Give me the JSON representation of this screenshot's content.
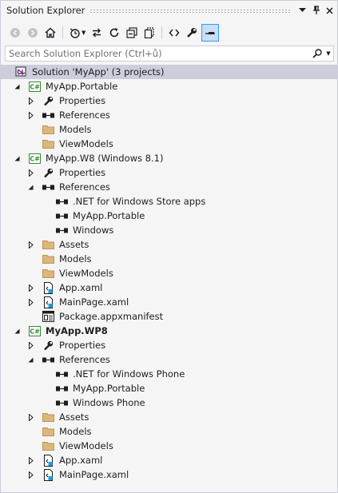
{
  "title": "Solution Explorer",
  "search": {
    "placeholder": "Search Solution Explorer (Ctrl+ů)"
  },
  "colors": {
    "folder": "#dcb67a",
    "selection": "#cccedb",
    "active_tool": "#3399ff",
    "csharp_green": "#388a34"
  },
  "solution": "Solution 'MyApp' (3 projects)",
  "projects": [
    {
      "name": "MyApp.Portable",
      "items": [
        {
          "label": "Properties",
          "icon": "wrench-icon"
        },
        {
          "label": "References",
          "icon": "references-icon"
        },
        {
          "label": "Models",
          "icon": "folder-icon"
        },
        {
          "label": "ViewModels",
          "icon": "folder-icon"
        }
      ]
    },
    {
      "name": "MyApp.W8 (Windows 8.1)",
      "items": [
        {
          "label": "Properties",
          "icon": "wrench-icon"
        },
        {
          "label": "References",
          "icon": "references-icon",
          "children": [
            ".NET for Windows Store apps",
            "MyApp.Portable",
            "Windows"
          ]
        },
        {
          "label": "Assets",
          "icon": "folder-icon"
        },
        {
          "label": "Models",
          "icon": "folder-icon"
        },
        {
          "label": "ViewModels",
          "icon": "folder-icon"
        },
        {
          "label": "App.xaml",
          "icon": "xaml-file-icon"
        },
        {
          "label": "MainPage.xaml",
          "icon": "xaml-file-icon"
        },
        {
          "label": "Package.appxmanifest",
          "icon": "manifest-icon"
        }
      ]
    },
    {
      "name": "MyApp.WP8",
      "items": [
        {
          "label": "Properties",
          "icon": "wrench-icon"
        },
        {
          "label": "References",
          "icon": "references-icon",
          "children": [
            ".NET for Windows Phone",
            "MyApp.Portable",
            "Windows Phone"
          ]
        },
        {
          "label": "Assets",
          "icon": "folder-icon"
        },
        {
          "label": "Models",
          "icon": "folder-icon"
        },
        {
          "label": "ViewModels",
          "icon": "folder-icon"
        },
        {
          "label": "App.xaml",
          "icon": "xaml-file-icon"
        },
        {
          "label": "MainPage.xaml",
          "icon": "xaml-file-icon"
        }
      ]
    }
  ]
}
